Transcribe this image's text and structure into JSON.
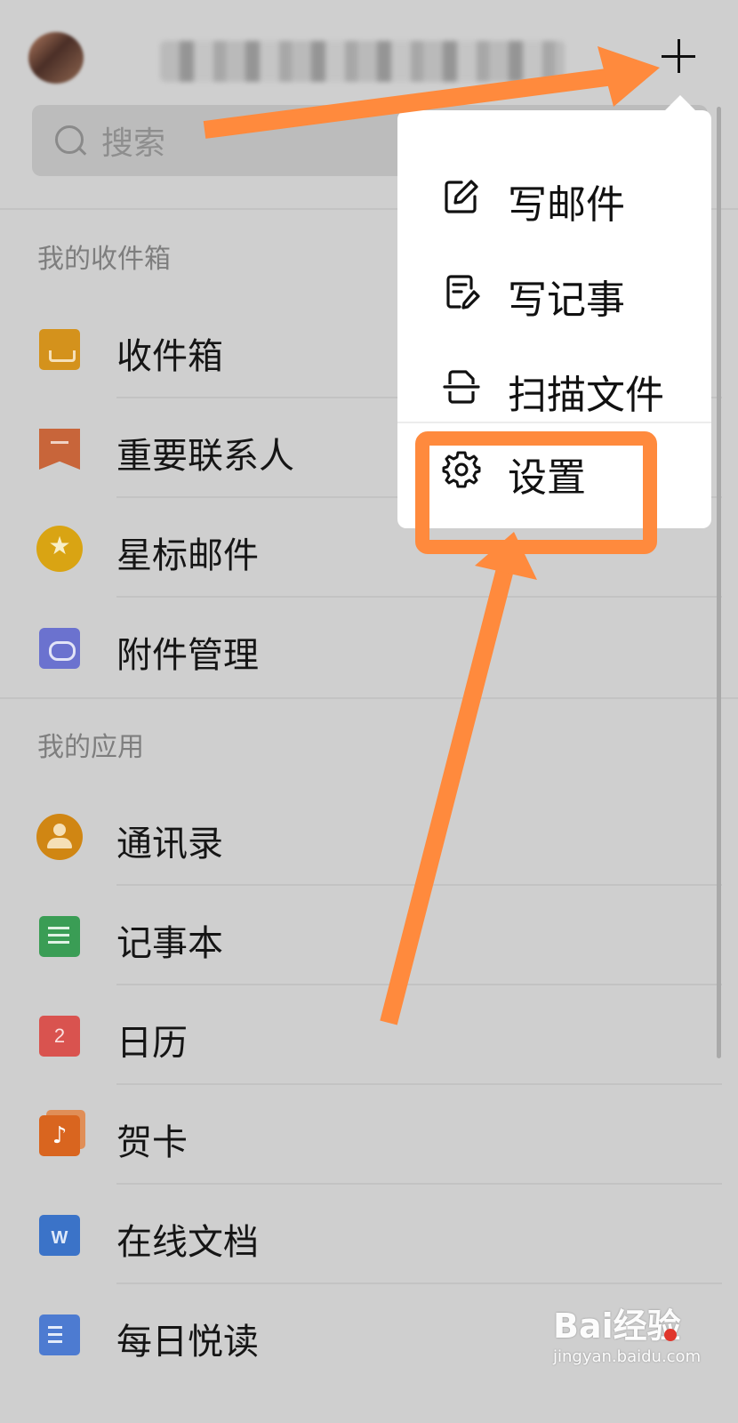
{
  "header": {
    "add_button_label": "+"
  },
  "search": {
    "placeholder": "搜索"
  },
  "sections": {
    "inbox_title": "我的收件箱",
    "apps_title": "我的应用"
  },
  "inbox_items": [
    {
      "label": "收件箱",
      "icon": "inbox-icon"
    },
    {
      "label": "重要联系人",
      "icon": "bookmark-icon"
    },
    {
      "label": "星标邮件",
      "icon": "star-icon"
    },
    {
      "label": "附件管理",
      "icon": "attachment-icon"
    }
  ],
  "app_items": [
    {
      "label": "通讯录",
      "icon": "contacts-icon"
    },
    {
      "label": "记事本",
      "icon": "notebook-icon"
    },
    {
      "label": "日历",
      "icon": "calendar-icon",
      "badge": "2"
    },
    {
      "label": "贺卡",
      "icon": "music-card-icon",
      "badge": "♪"
    },
    {
      "label": "在线文档",
      "icon": "word-doc-icon",
      "badge": "W"
    },
    {
      "label": "每日悦读",
      "icon": "reading-icon"
    }
  ],
  "popup_menu": [
    {
      "label": "写邮件",
      "icon": "compose-icon"
    },
    {
      "label": "写记事",
      "icon": "note-edit-icon"
    },
    {
      "label": "扫描文件",
      "icon": "scan-icon"
    },
    {
      "label": "设置",
      "icon": "gear-icon"
    }
  ],
  "watermark": {
    "main": "Bai经验",
    "sub": "jingyan.baidu.com"
  },
  "colors": {
    "annotation_orange": "#ff8a3d",
    "dimmed_background": "#cfcfcf",
    "popup_background": "#ffffff"
  }
}
